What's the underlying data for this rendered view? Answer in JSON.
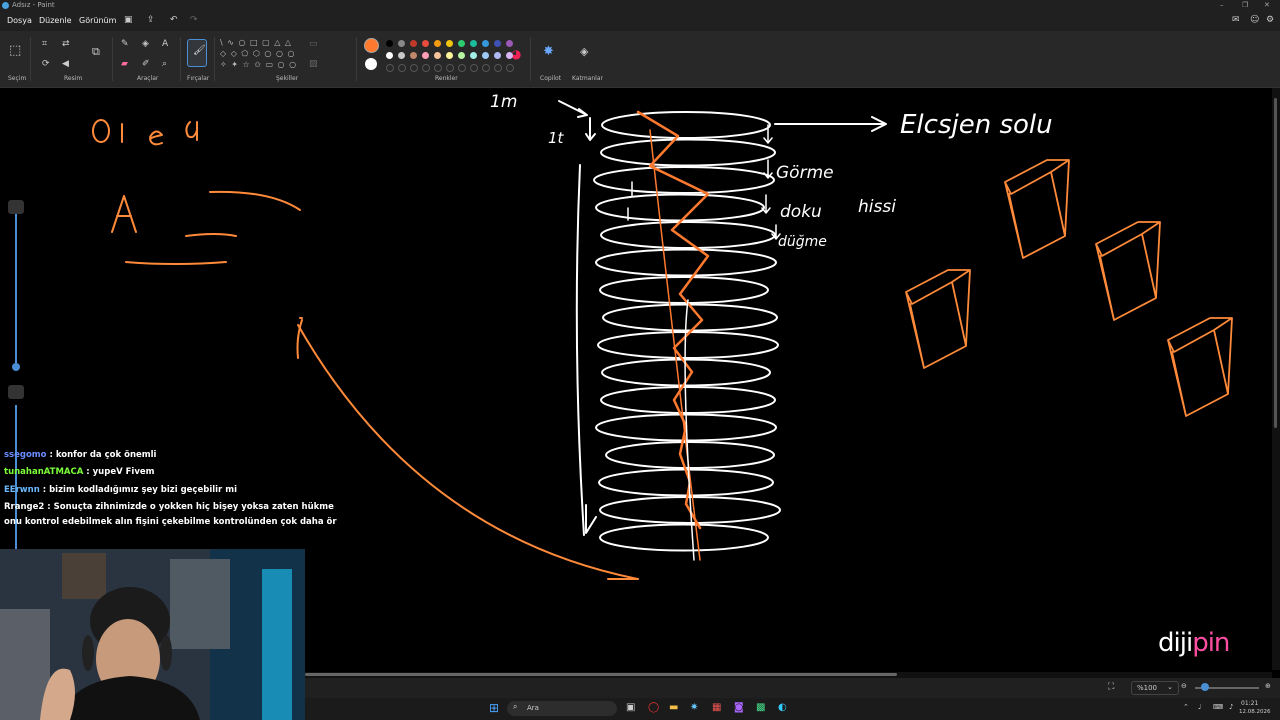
{
  "window": {
    "title": "Adsız - Paint"
  },
  "menu": {
    "file": "Dosya",
    "edit": "Düzenle",
    "view": "Görünüm"
  },
  "ribbon": {
    "groups": {
      "selection": "Seçim",
      "image": "Resim",
      "tools": "Araçlar",
      "brushes": "Fırçalar",
      "shapes": "Şekiller",
      "colors": "Renkler",
      "copilot": "Copilot",
      "layers": "Katmanlar"
    },
    "palette_row1": [
      "#000000",
      "#888888",
      "#c0392b",
      "#e74c3c",
      "#f39c12",
      "#f1c40f",
      "#2ecc71",
      "#1abc9c",
      "#3498db",
      "#3f51b5",
      "#9b59b6"
    ],
    "palette_row2": [
      "#ffffff",
      "#c8c8c8",
      "#c0876a",
      "#ff9eb5",
      "#f5c49b",
      "#fff59d",
      "#b8f5a0",
      "#a0f0e8",
      "#9ecbf5",
      "#b0b8f5",
      "#d7b5f5"
    ],
    "primary_color": "#ff7a2f",
    "secondary_color": "#ffffff"
  },
  "canvas_text": {
    "top_label": "1m",
    "side_label": "1t",
    "arrow_label": "Elcsjen solu",
    "label_gorme": "Görme",
    "label_doku": "doku",
    "label_hissi": "hissi",
    "label_dugme": "düğme",
    "orange_word": "ol ed",
    "orange_a": "A"
  },
  "chat": [
    {
      "user": "ssegomo",
      "color": "#6b8cff",
      "text": "konfor da çok önemli"
    },
    {
      "user": "tunahanATMACA",
      "color": "#7cff3a",
      "text": "yupeV Fivem"
    },
    {
      "user": "EErwnn",
      "color": "#6bb8ff",
      "text": "bizim kodladığımız şey bizi geçebilir mi"
    },
    {
      "user": "Rrange2",
      "color": "#ffffff",
      "text": "Sonuçta zihnimizde o yokken hiç bişey yoksa zaten hükme"
    },
    {
      "user": "",
      "color": "#ffffff",
      "text": "onu kontrol edebilmek alın fişini çekebilme kontrolünden çok daha ör"
    }
  ],
  "status": {
    "zoom": "%100"
  },
  "taskbar": {
    "search_placeholder": "Ara",
    "time": "01:21",
    "date": "12.08.2026"
  },
  "watermark": {
    "part1": "diji",
    "part2": "pin"
  }
}
